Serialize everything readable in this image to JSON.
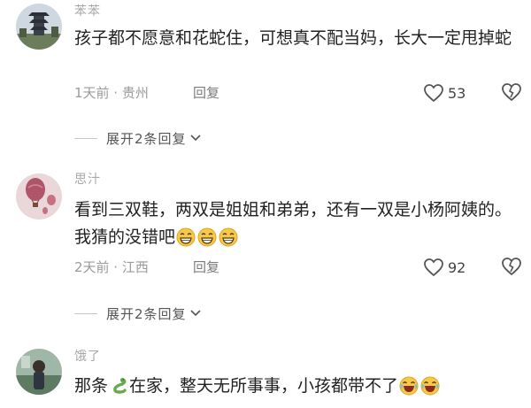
{
  "comments": [
    {
      "username": "苯苯",
      "content": "孩子都不愿意和花蛇住，可想真不配当妈，长大一定甩掉蛇",
      "meta": "1天前 · 贵州",
      "reply_label": "回复",
      "likes": "53",
      "expand_label": "展开2条回复"
    },
    {
      "username": "思汁",
      "content_text": "看到三双鞋，两双是姐姐和弟弟，还有一双是小杨阿姨的。我猜的没错吧",
      "content_emojis": [
        "grin-emoji",
        "grin-emoji",
        "grin-emoji"
      ],
      "meta": "2天前 · 江西",
      "reply_label": "回复",
      "likes": "92",
      "expand_label": "展开2条回复"
    },
    {
      "username": "饿了",
      "content_before": "那条",
      "content_after": "在家，整天无所事事，小孩都带不了",
      "content_emojis": [
        "snake-emoji",
        "laugh-cry-emoji",
        "laugh-cry-emoji"
      ]
    }
  ],
  "colors": {
    "text": "#222222",
    "meta": "#9a9a9a",
    "username": "#a8a8a8",
    "background": "#ffffff"
  },
  "icons": [
    "heart-outline-icon",
    "broken-heart-icon",
    "chevron-down-icon"
  ]
}
